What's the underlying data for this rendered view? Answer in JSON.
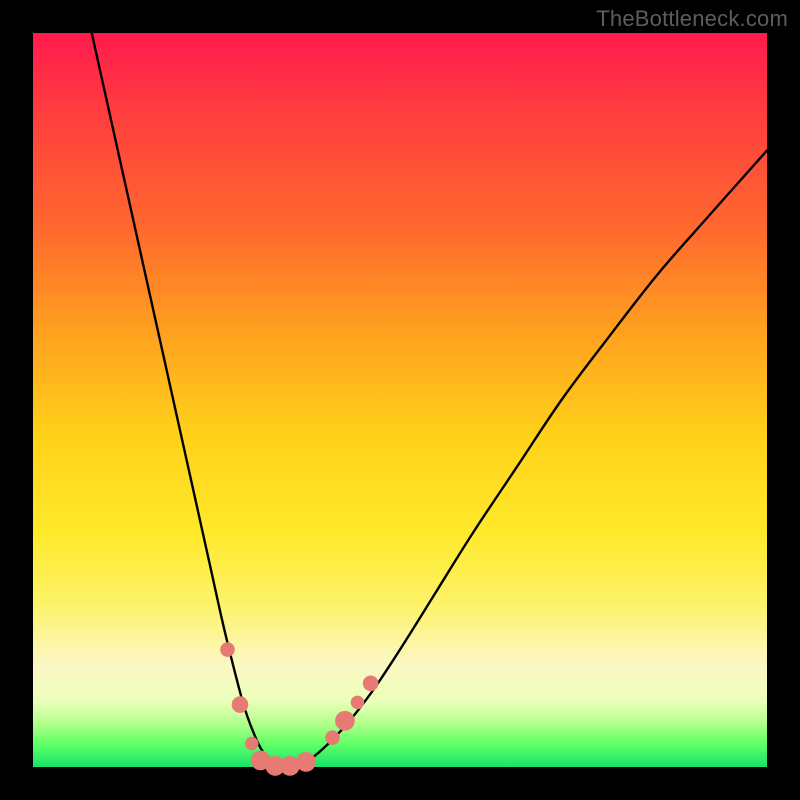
{
  "watermark": "TheBottleneck.com",
  "colors": {
    "curve_stroke": "#000000",
    "marker_fill": "#e77b74",
    "marker_stroke": "#d45a50",
    "frame": "#000000"
  },
  "chart_data": {
    "type": "line",
    "title": "",
    "xlabel": "",
    "ylabel": "",
    "xlim": [
      0,
      100
    ],
    "ylim": [
      0,
      100
    ],
    "grid": false,
    "series": [
      {
        "name": "bottleneck-curve",
        "x": [
          8,
          10,
          12,
          14,
          16,
          18,
          20,
          22,
          24,
          26,
          28,
          29,
          30,
          31,
          32,
          33,
          34,
          36,
          38,
          42,
          46,
          50,
          55,
          60,
          66,
          72,
          78,
          85,
          92,
          100
        ],
        "values": [
          100,
          91,
          82,
          73,
          64,
          55,
          46,
          37,
          28,
          19,
          11,
          7.5,
          4.8,
          2.6,
          1.2,
          0.4,
          0.15,
          0.2,
          1.2,
          5,
          10,
          16,
          24,
          32,
          41,
          50,
          58,
          67,
          75,
          84
        ]
      }
    ],
    "markers": [
      {
        "x": 26.5,
        "y": 16,
        "r": 1.4
      },
      {
        "x": 28.2,
        "y": 8.5,
        "r": 1.6
      },
      {
        "x": 29.8,
        "y": 3.2,
        "r": 1.3
      },
      {
        "x": 31.0,
        "y": 0.9,
        "r": 1.9
      },
      {
        "x": 33.0,
        "y": 0.15,
        "r": 1.9
      },
      {
        "x": 35.0,
        "y": 0.15,
        "r": 1.9
      },
      {
        "x": 37.2,
        "y": 0.7,
        "r": 1.9
      },
      {
        "x": 40.8,
        "y": 4.0,
        "r": 1.4
      },
      {
        "x": 42.5,
        "y": 6.3,
        "r": 1.9
      },
      {
        "x": 44.2,
        "y": 8.8,
        "r": 1.3
      },
      {
        "x": 46.0,
        "y": 11.4,
        "r": 1.5
      }
    ]
  }
}
